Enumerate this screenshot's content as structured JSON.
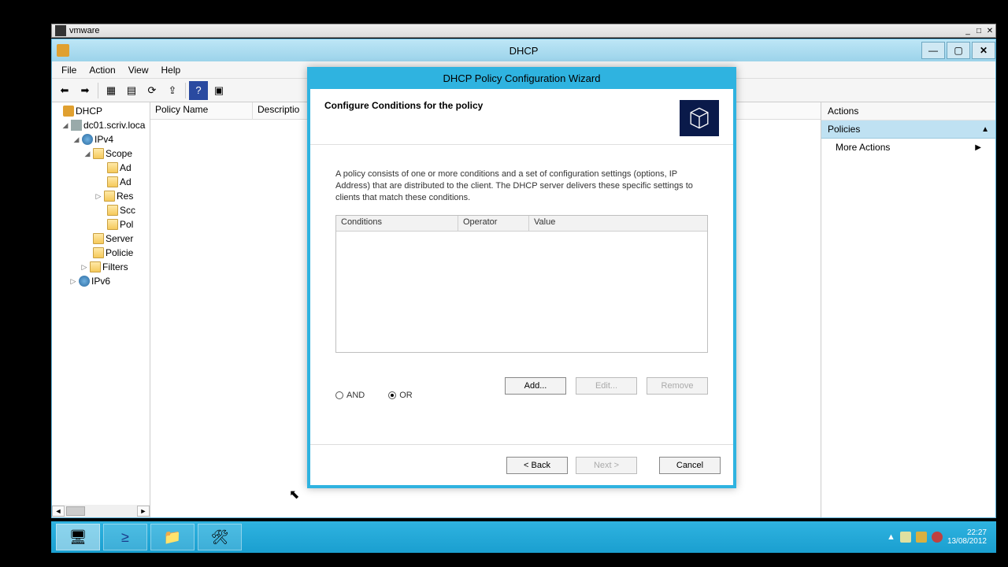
{
  "vmware": {
    "title": "vmware"
  },
  "app": {
    "title": "DHCP",
    "menu": [
      "File",
      "Action",
      "View",
      "Help"
    ]
  },
  "tree": {
    "root": "DHCP",
    "server": "dc01.scriv.loca",
    "ipv4": "IPv4",
    "scope": "Scope",
    "items": [
      "Ad",
      "Ad",
      "Res",
      "Scc",
      "Pol"
    ],
    "server_opts": "Server",
    "policies": "Policie",
    "filters": "Filters",
    "ipv6": "IPv6"
  },
  "main": {
    "col1": "Policy Name",
    "col2": "Descriptio"
  },
  "actions": {
    "title": "Actions",
    "section": "Policies",
    "more": "More Actions"
  },
  "wizard": {
    "title": "DHCP Policy Configuration Wizard",
    "heading": "Configure Conditions for the policy",
    "desc": "A policy consists of one or more conditions and a set of configuration settings (options, IP Address) that are distributed to the client. The DHCP server delivers these specific settings to clients that match these conditions.",
    "cols": {
      "c1": "Conditions",
      "c2": "Operator",
      "c3": "Value"
    },
    "and": "AND",
    "or": "OR",
    "add": "Add...",
    "edit": "Edit...",
    "remove": "Remove",
    "back": "< Back",
    "next": "Next >",
    "cancel": "Cancel"
  },
  "tray": {
    "time": "22:27",
    "date": "13/08/2012"
  }
}
